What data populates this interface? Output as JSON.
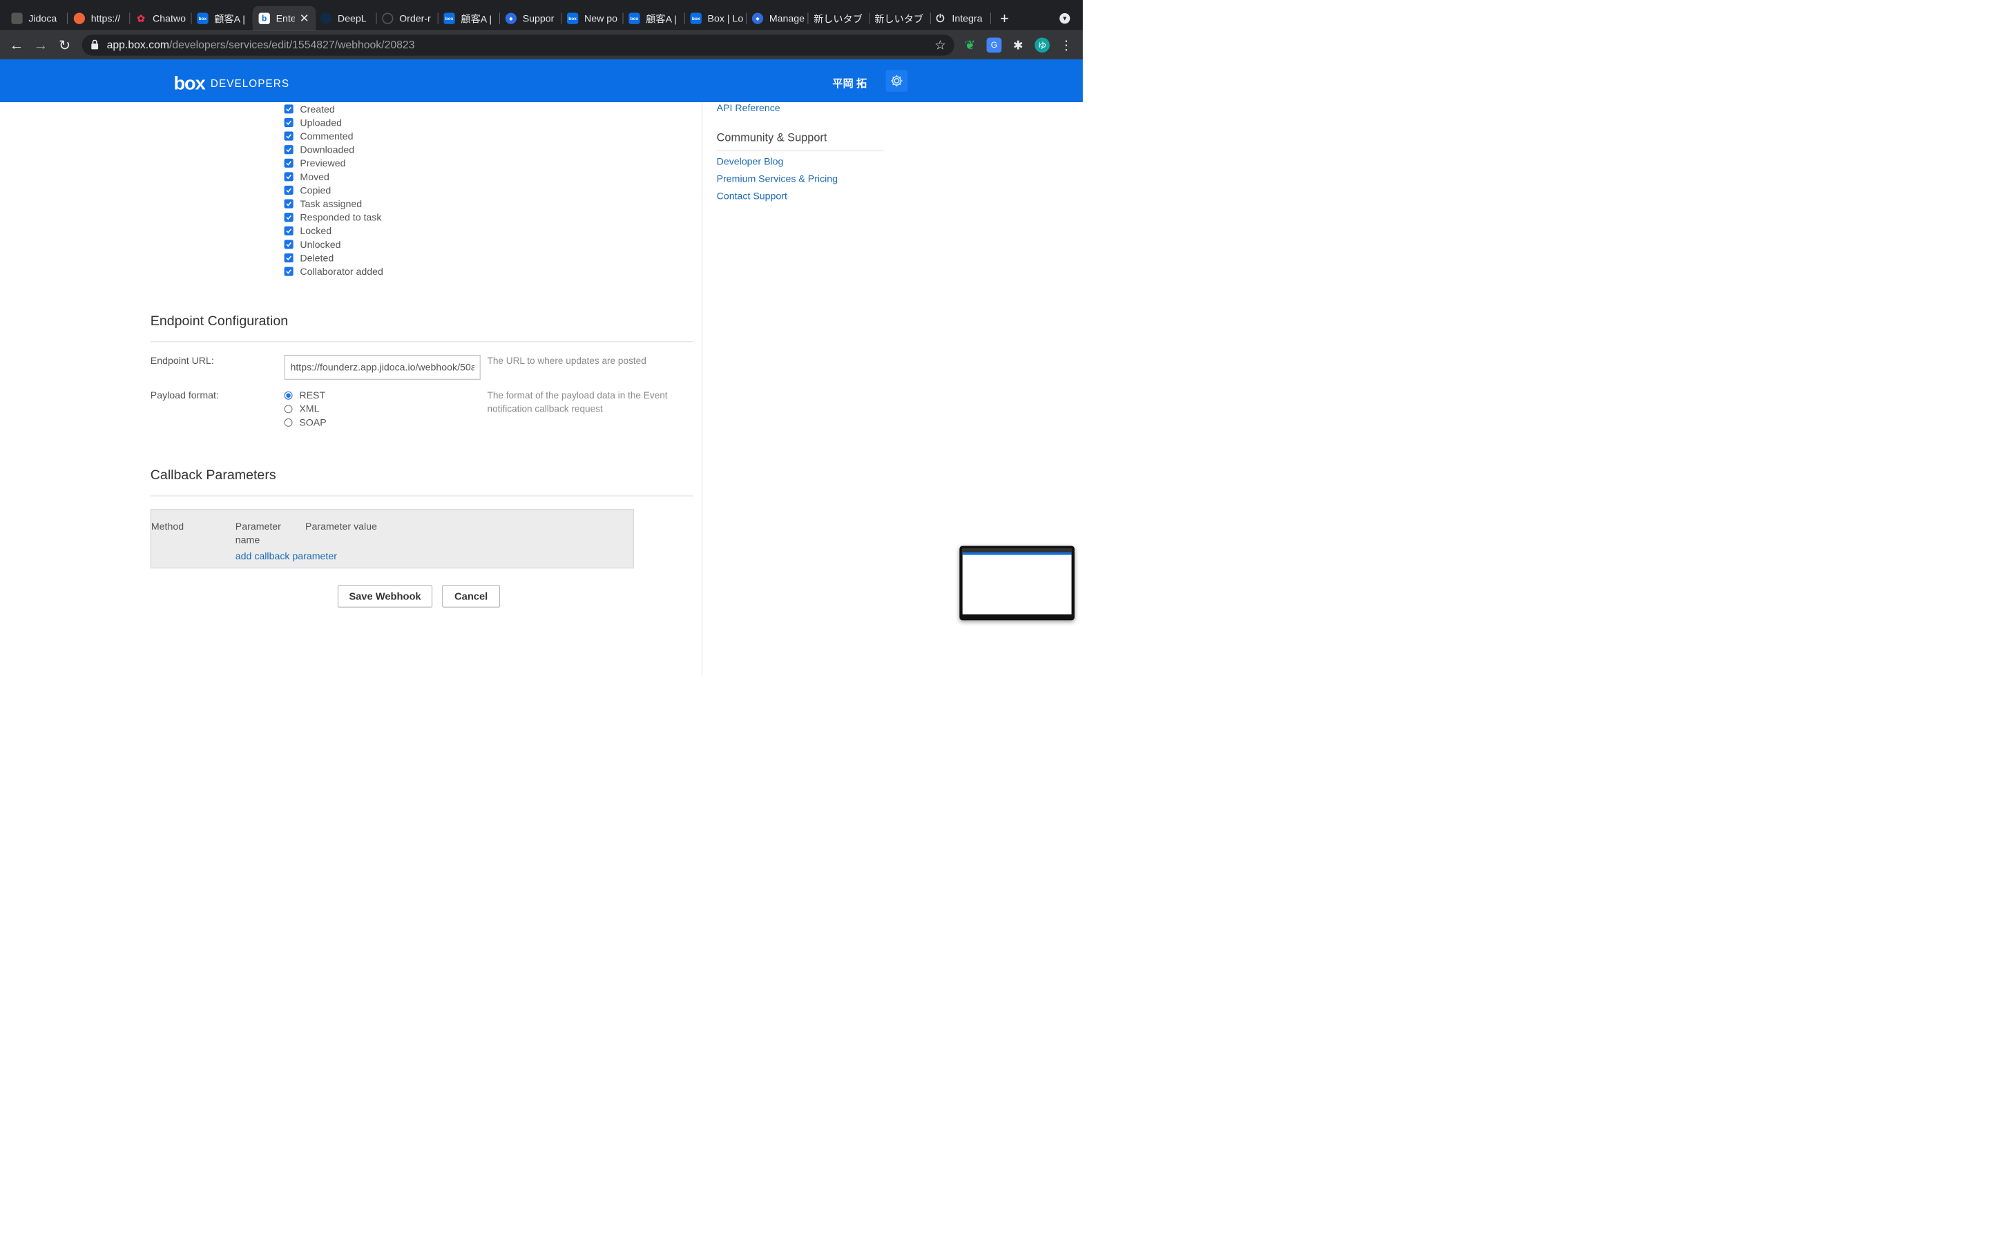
{
  "browser": {
    "tabs": [
      {
        "label": "Jidoca",
        "icon": "jidoca-icon"
      },
      {
        "label": "https://",
        "icon": "orange-circle-icon"
      },
      {
        "label": "Chatwo",
        "icon": "chatwork-icon"
      },
      {
        "label": "顧客A |",
        "icon": "box-icon"
      },
      {
        "label": "Ente",
        "icon": "box-b-icon"
      },
      {
        "label": "DeepL",
        "icon": "deepl-icon"
      },
      {
        "label": "Order-r",
        "icon": "loading-icon"
      },
      {
        "label": "顧客A |",
        "icon": "box-icon"
      },
      {
        "label": "Suppor",
        "icon": "support-icon"
      },
      {
        "label": "New po",
        "icon": "box-icon"
      },
      {
        "label": "顧客A |",
        "icon": "box-icon"
      },
      {
        "label": "Box | Lo",
        "icon": "box-icon"
      },
      {
        "label": "Manage",
        "icon": "support-icon"
      },
      {
        "label": "新しいタブ",
        "icon": ""
      },
      {
        "label": "新しいタブ",
        "icon": ""
      },
      {
        "label": "Integra",
        "icon": "power-icon"
      }
    ],
    "url_host": "app.box.com",
    "url_path": "/developers/services/edit/1554827/webhook/20823",
    "profile_initial": "ゆ"
  },
  "header": {
    "logo": "box",
    "product": "DEVELOPERS",
    "user_name": "平岡 拓"
  },
  "triggers": [
    "Created",
    "Uploaded",
    "Commented",
    "Downloaded",
    "Previewed",
    "Moved",
    "Copied",
    "Task assigned",
    "Responded to task",
    "Locked",
    "Unlocked",
    "Deleted",
    "Collaborator added"
  ],
  "endpoint": {
    "section_title": "Endpoint Configuration",
    "url_label": "Endpoint URL:",
    "url_value": "https://founderz.app.jidoca.io/webhook/50a",
    "url_help": "The URL to where updates are posted",
    "payload_label": "Payload format:",
    "payload_options": [
      "REST",
      "XML",
      "SOAP"
    ],
    "payload_selected": "REST",
    "payload_help_1": "The format of the payload data in the Event",
    "payload_help_2": "notification callback request"
  },
  "callback": {
    "section_title": "Callback Parameters",
    "col_method": "Method",
    "col_param_name_1": "Parameter",
    "col_param_name_2": "name",
    "col_param_value": "Parameter value",
    "add_link": "add callback parameter"
  },
  "actions": {
    "save": "Save Webhook",
    "cancel": "Cancel"
  },
  "sidebar": {
    "api_reference": "API Reference",
    "community_title": "Community & Support",
    "links": [
      "Developer Blog",
      "Premium Services & Pricing",
      "Contact Support"
    ]
  }
}
